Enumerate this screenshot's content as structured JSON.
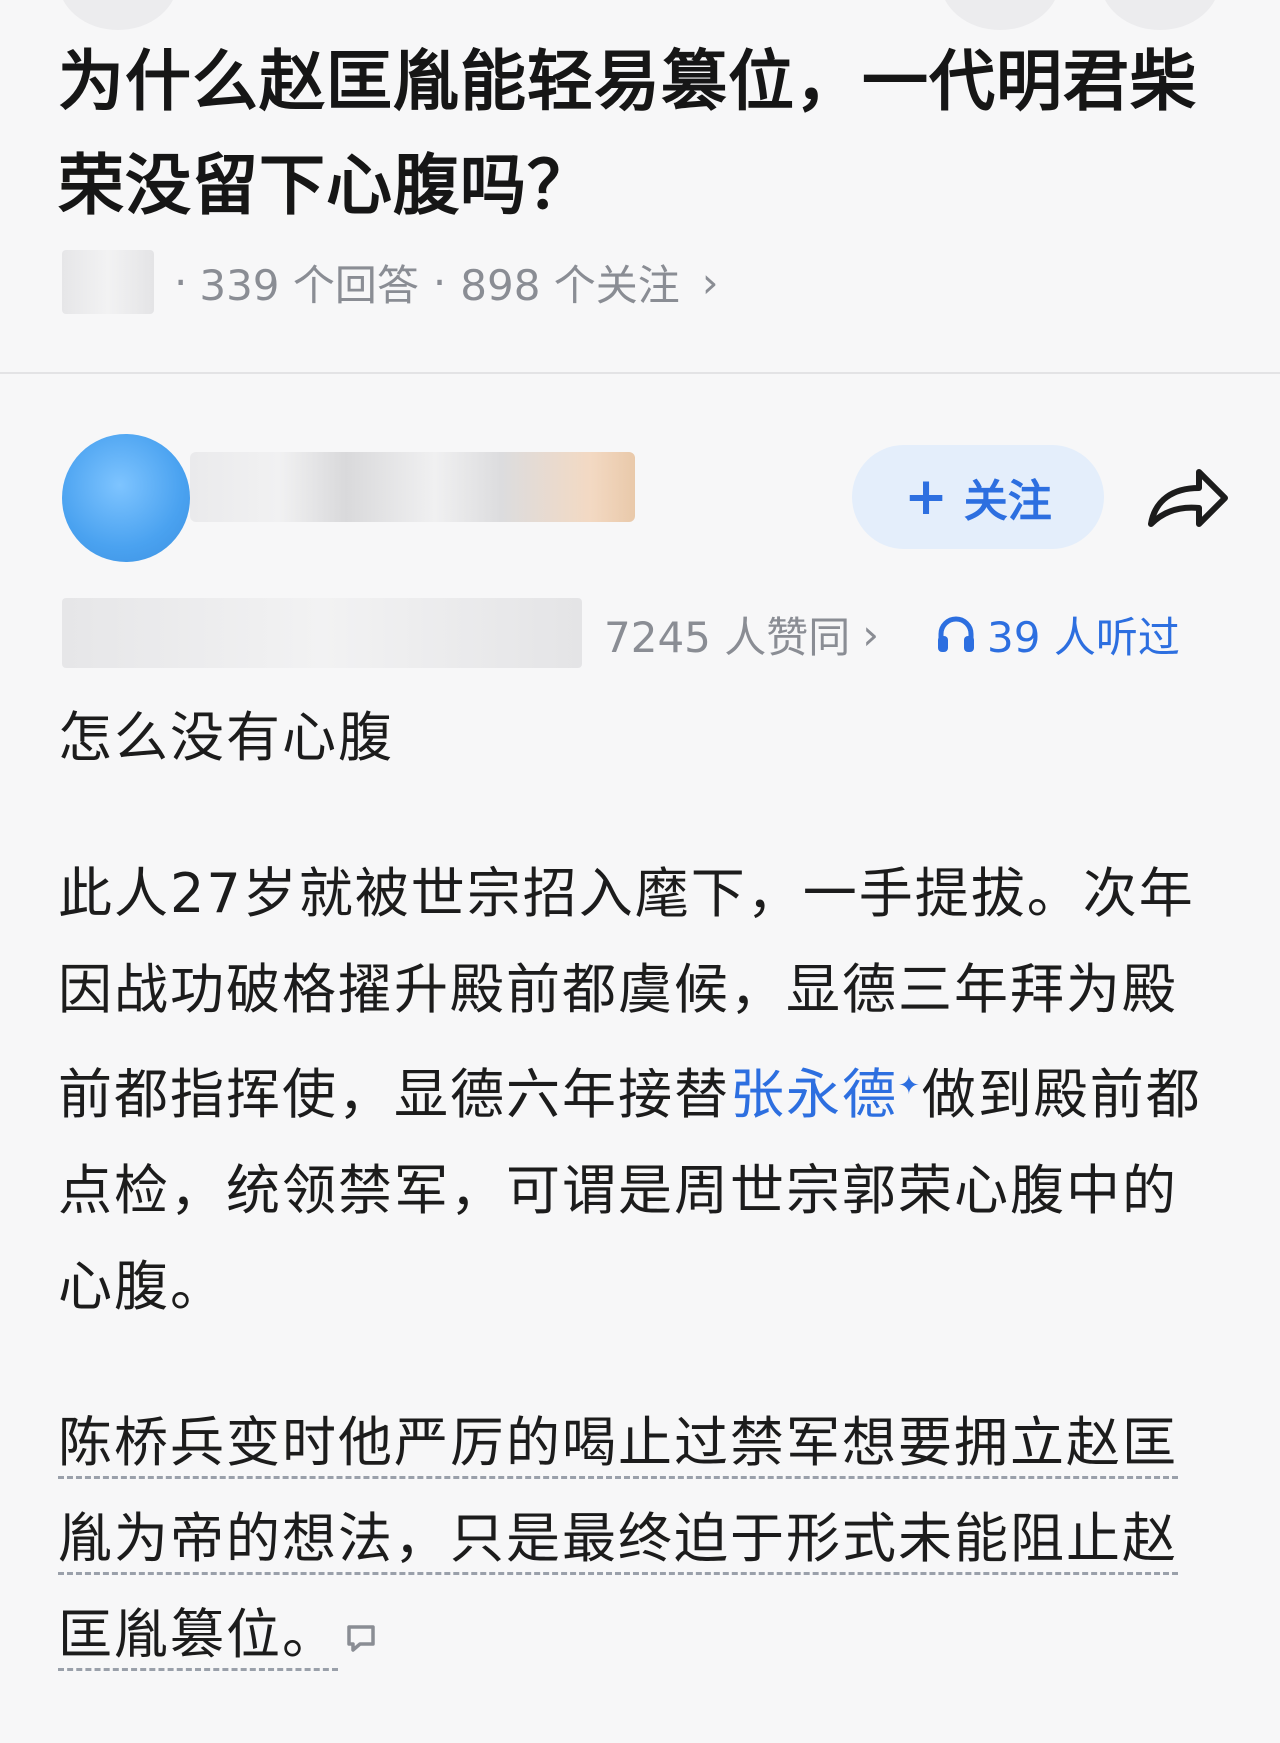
{
  "question": {
    "title": "为什么赵匡胤能轻易篡位，一代明君柴荣没留下心腹吗？",
    "answers_count": "339 个回答",
    "followers_count": "898 个关注",
    "separator": "·",
    "chevron": "›"
  },
  "author": {
    "follow_label": "关注",
    "follow_plus": "+"
  },
  "stats": {
    "upvotes": "7245 人赞同",
    "upvotes_chevron": "›",
    "listened": "39 人听过"
  },
  "answer": {
    "p1": "怎么没有心腹",
    "p2_before_link": "此人27岁就被世宗招入麾下，一手提拔。次年因战功破格擢升殿前都虞候，显德三年拜为殿前都指挥使，显德六年接替",
    "p2_link": "张永德",
    "p2_spark": "✦",
    "p2_after_link": "做到殿前都点检，统领禁军，可谓是周世宗郭荣心腹中的心腹。",
    "p3": "陈桥兵变时他严厉的喝止过禁军想要拥立赵匡胤为帝的想法，只是最终迫于形式未能阻止赵匡胤篡位。"
  },
  "icons": {
    "share": "share-icon",
    "headphones": "headphones-icon",
    "comment": "comment-icon"
  },
  "colors": {
    "accent": "#2d6fe0",
    "meta_gray": "#8a8d94",
    "follow_bg": "#e4eefb"
  }
}
